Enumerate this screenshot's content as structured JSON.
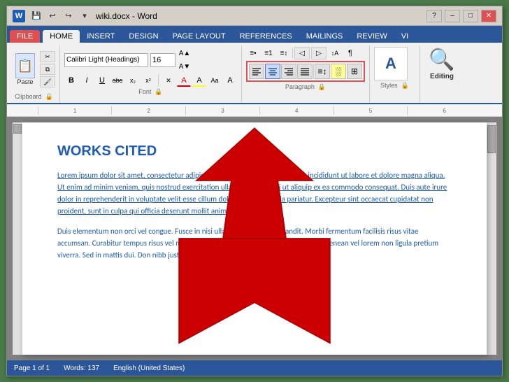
{
  "titlebar": {
    "title": "wiki.docx - Word",
    "app_icon": "W",
    "help": "?",
    "minimize": "–",
    "restore": "□",
    "close": "✕"
  },
  "qat": {
    "save": "💾",
    "undo": "↩",
    "redo": "↪",
    "more": "▾"
  },
  "tabs": [
    {
      "label": "FILE",
      "type": "file"
    },
    {
      "label": "HOME",
      "active": true
    },
    {
      "label": "INSERT"
    },
    {
      "label": "DESIGN"
    },
    {
      "label": "PAGE LAYOUT"
    },
    {
      "label": "REFERENCES"
    },
    {
      "label": "MAILINGS"
    },
    {
      "label": "REVIEW"
    },
    {
      "label": "VI"
    }
  ],
  "ribbon": {
    "clipboard": {
      "label": "Clipboard",
      "paste": "Paste",
      "cut": "✂",
      "copy": "⧉",
      "format": "🖌"
    },
    "font": {
      "label": "Font",
      "face": "Calibri Light (Headings)",
      "size": "16",
      "bold": "B",
      "italic": "I",
      "underline": "U",
      "strikethrough": "abc",
      "subscript": "x₂",
      "superscript": "x²",
      "clear": "✕",
      "color_a": "A",
      "highlight": "A"
    },
    "paragraph": {
      "label": "Paragraph",
      "align_left": "≡",
      "align_center": "≡",
      "align_right": "≡",
      "justify": "≡"
    },
    "styles": {
      "label": "Styles",
      "icon": "A"
    },
    "editing": {
      "label": "Editing",
      "text": "Editing"
    }
  },
  "ruler": {
    "marks": [
      "1",
      "2",
      "3",
      "4",
      "5",
      "6"
    ]
  },
  "document": {
    "heading": "WORKS CITED",
    "paragraph1": "Lorem ipsum dolor sit amet, consectetur adipiscing elit, sed do eiusmod tempor incididunt ut labore et dolore magna aliqua. Ut enim ad minim veniam, quis nostrud exercitation ullamco laboris nisi ut aliquip ex ea commodo consequat. Duis aute irure dolor in reprehenderit in voluptate velit esse cillum dolore eu fugiat nulla pariatur. Excepteur sint occaecat cupidatat non proident, sunt in culpa qui officia deserunt mollit anim id est laborum.\".",
    "paragraph2": "Duis elementum non orci vel congue. Fusce in nisi ullamcorper, gravida blandit. Morbi fermentum facilisis risus vitae accumsan. Curabitur tempus risus vel metus vestibulum, quis suscipit purus molestie. Aenean vel lorem non ligula pretium viverra. Sed in mattis dui. Don nibb juste. Praesent rhoncus magna sit amet lorem."
  },
  "statusbar": {
    "page": "Page 1 of 1",
    "words": "Words: 137",
    "language": "English (United States)"
  }
}
